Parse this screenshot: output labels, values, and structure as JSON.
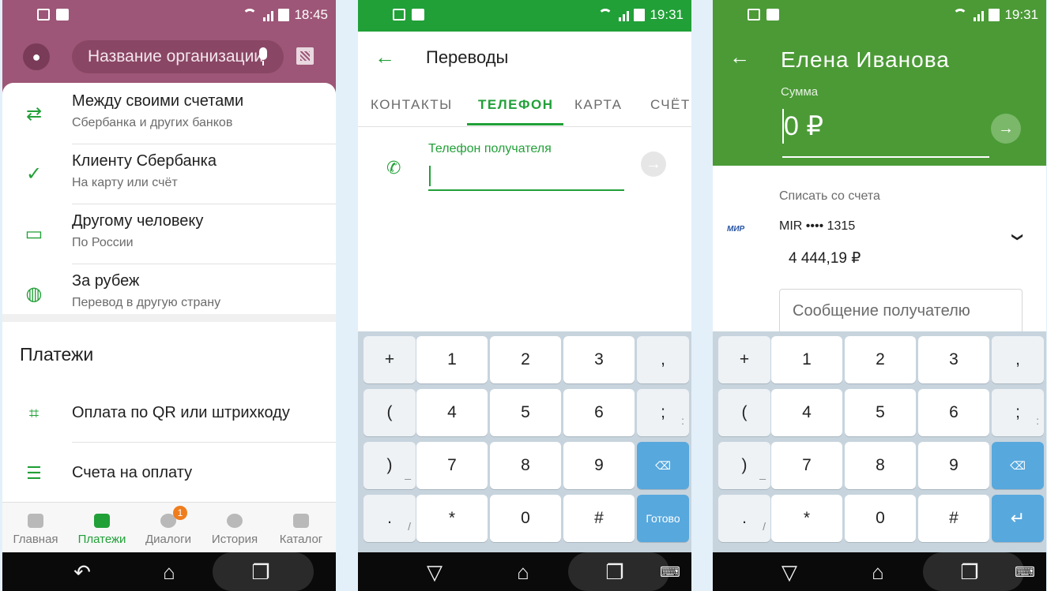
{
  "screen1": {
    "time": "18:45",
    "search_placeholder": "Название организации",
    "transfers": [
      {
        "title": "Между своими счетами",
        "subtitle": "Сбербанка и других банков",
        "icon": "arrows-exchange-icon"
      },
      {
        "title": "Клиенту Сбербанка",
        "subtitle": "На карту или счёт",
        "icon": "sberbank-logo-icon"
      },
      {
        "title": "Другому человеку",
        "subtitle": "По России",
        "icon": "card-icon"
      },
      {
        "title": "За рубеж",
        "subtitle": "Перевод в другую страну",
        "icon": "globe-icon"
      }
    ],
    "payments_title": "Платежи",
    "payments": [
      {
        "title": "Оплата по QR или штрихкоду",
        "icon": "qr-scan-icon"
      },
      {
        "title": "Счета на оплату",
        "icon": "invoice-icon"
      }
    ],
    "tabs": [
      {
        "label": "Главная",
        "icon": "home-icon"
      },
      {
        "label": "Платежи",
        "icon": "transfer-icon"
      },
      {
        "label": "Диалоги",
        "icon": "chat-icon",
        "badge": "1"
      },
      {
        "label": "История",
        "icon": "clock-icon"
      },
      {
        "label": "Каталог",
        "icon": "cart-icon"
      }
    ],
    "active_tab": "Платежи"
  },
  "screen2": {
    "time": "19:31",
    "title": "Переводы",
    "tabs": [
      "КОНТАКТЫ",
      "ТЕЛЕФОН",
      "КАРТА",
      "СЧЁТ"
    ],
    "active_tab": "ТЕЛЕФОН",
    "field_label": "Телефон получателя",
    "field_value": "",
    "keyboard": {
      "side_left": [
        "+",
        "(",
        ")",
        "."
      ],
      "side_left_sub": [
        "",
        "",
        "_",
        "/"
      ],
      "digits": [
        [
          "1",
          "2",
          "3"
        ],
        [
          "4",
          "5",
          "6"
        ],
        [
          "7",
          "8",
          "9"
        ],
        [
          "*",
          "0",
          "#"
        ]
      ],
      "side_right": [
        ",",
        ";",
        "⌫",
        "Готово"
      ],
      "side_right_sub": [
        "",
        ":",
        "",
        ""
      ]
    }
  },
  "screen3": {
    "time": "19:31",
    "recipient": "Елена Иванова",
    "amount_label": "Сумма",
    "amount_value": "0 ₽",
    "debit_label": "Списать со счета",
    "card_brand": "МИР",
    "card_name": "MIR •••• 1315",
    "balance": "4 444,19 ₽",
    "message_placeholder": "Сообщение получателю",
    "keyboard": {
      "side_left": [
        "+",
        "(",
        ")",
        "."
      ],
      "side_left_sub": [
        "",
        "",
        "_",
        "/"
      ],
      "digits": [
        [
          "1",
          "2",
          "3"
        ],
        [
          "4",
          "5",
          "6"
        ],
        [
          "7",
          "8",
          "9"
        ],
        [
          "*",
          "0",
          "#"
        ]
      ],
      "side_right": [
        ",",
        ";",
        "⌫",
        "↵"
      ],
      "side_right_sub": [
        "",
        ":",
        "",
        ""
      ]
    }
  },
  "colors": {
    "sber_green": "#21a038",
    "header_purple": "#9d5677",
    "header_green": "#4b9a36",
    "key_blue": "#57a8dd"
  }
}
